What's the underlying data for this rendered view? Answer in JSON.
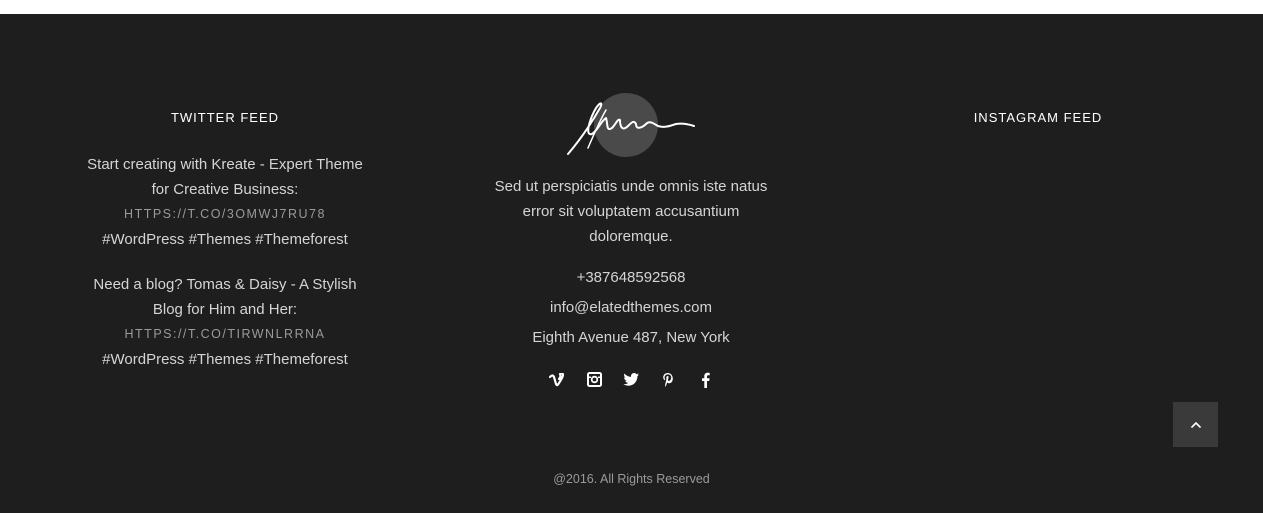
{
  "twitter": {
    "title": "TWITTER FEED",
    "tweets": [
      {
        "text": "Start creating with Kreate - Expert Theme for Creative Business:",
        "link": "HTTPS://T.CO/3OMWJ7RU78",
        "tags": "#WordPress #Themes #Themeforest"
      },
      {
        "text": "Need a blog? Tomas & Daisy - A Stylish Blog for Him and Her:",
        "link": "HTTPS://T.CO/TIRWNLRRNA",
        "tags": "#WordPress #Themes #Themeforest"
      }
    ]
  },
  "about": {
    "text": "Sed ut perspiciatis unde omnis iste natus error sit voluptatem accusantium doloremque.",
    "phone": "+387648592568",
    "email": "info@elatedthemes.com",
    "address": "Eighth Avenue 487, New York",
    "socials": [
      "vimeo-icon",
      "instagram-icon",
      "twitter-icon",
      "pinterest-icon",
      "facebook-icon"
    ]
  },
  "instagram": {
    "title": "INSTAGRAM FEED"
  },
  "copyright": "@2016. All Rights Reserved",
  "colors": {
    "footer_bg": "#1e1e1e",
    "back_to_top_bg": "#3a3a3a",
    "signature_circle": "#4a4a4a"
  }
}
